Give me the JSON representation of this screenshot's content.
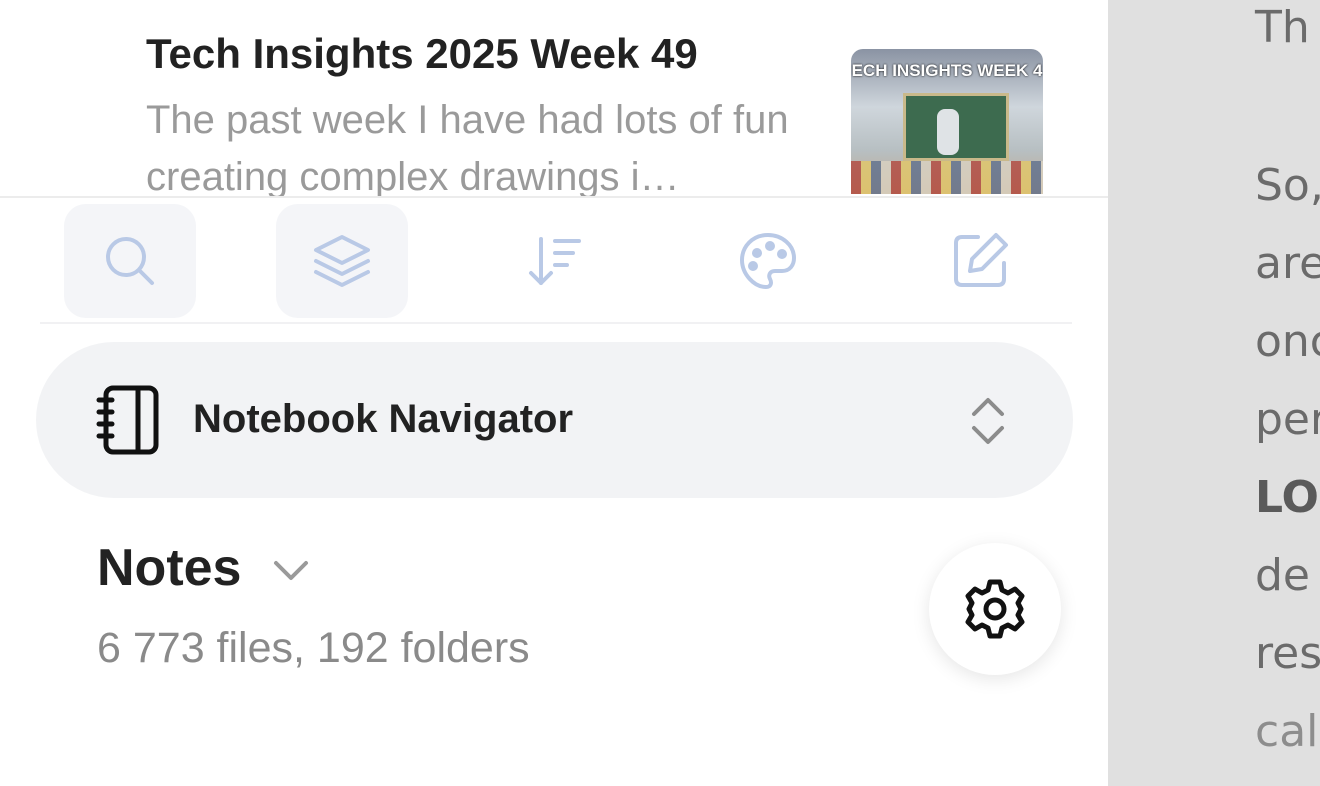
{
  "file_item": {
    "title": "Tech Insights 2025 Week 49",
    "preview": "The past week I have had lots of fun creating complex drawings i…",
    "thumbnail_banner": "ECH INSIGHTS WEEK 4"
  },
  "toolbar": {
    "buttons": [
      {
        "name": "search",
        "icon": "search-icon",
        "active": true
      },
      {
        "name": "layers",
        "icon": "layers-icon",
        "active": true
      },
      {
        "name": "sort",
        "icon": "sort-icon",
        "active": false
      },
      {
        "name": "appearance",
        "icon": "palette-icon",
        "active": false
      },
      {
        "name": "new-note",
        "icon": "edit-icon",
        "active": false
      }
    ]
  },
  "vault": {
    "name": "Notebook Navigator",
    "icon": "notebook-icon"
  },
  "folder": {
    "name": "Notes",
    "stats": "6 773 files, 192 folders"
  },
  "editor": {
    "lines": [
      "Th",
      "",
      "So,",
      "are",
      "onc",
      "per",
      "LO",
      "de",
      "res",
      "cal"
    ]
  },
  "colors": {
    "accent_icon": "#b9c9e6",
    "right_pane_bg": "#e0e0e0",
    "vault_bg": "#f2f3f5"
  }
}
